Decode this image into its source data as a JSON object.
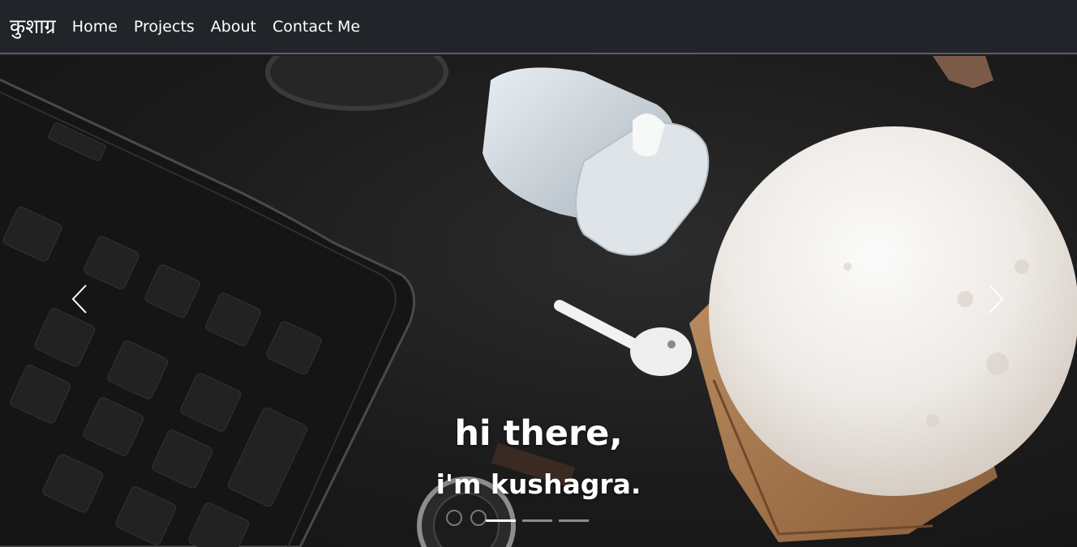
{
  "navbar": {
    "brand": "कुशाग्र",
    "links": [
      "Home",
      "Projects",
      "About",
      "Contact Me"
    ]
  },
  "carousel": {
    "caption_title": "hi there,",
    "caption_subtitle": "i'm kushagra.",
    "slide_count": 3,
    "active_slide": 0,
    "prev_icon": "chevron-left-icon",
    "next_icon": "chevron-right-icon"
  },
  "colors": {
    "navbar_bg": "#212529",
    "text": "#ffffff"
  }
}
